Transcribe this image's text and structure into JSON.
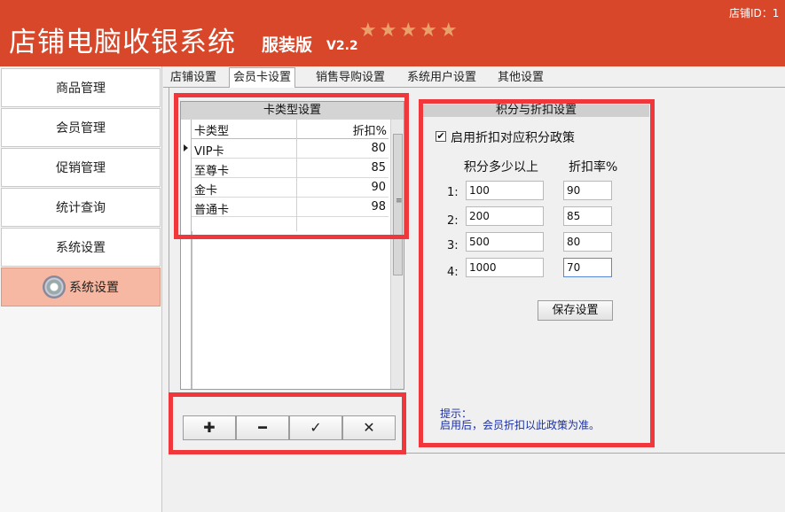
{
  "header": {
    "title": "店铺电脑收银系统",
    "edition": "服装版",
    "version": "V2.2",
    "stars": "★★★★★",
    "shop_id": "店铺ID：1"
  },
  "sidebar": {
    "items": [
      {
        "label": "商品管理"
      },
      {
        "label": "会员管理"
      },
      {
        "label": "促销管理"
      },
      {
        "label": "统计查询"
      },
      {
        "label": "系统设置"
      },
      {
        "label": "系统设置",
        "active": true
      }
    ]
  },
  "tabs": [
    {
      "label": "店铺设置"
    },
    {
      "label": "会员卡设置",
      "active": true
    },
    {
      "label": "销售导购设置"
    },
    {
      "label": "系统用户设置"
    },
    {
      "label": "其他设置"
    }
  ],
  "card_grid": {
    "caption": "卡类型设置",
    "columns": [
      "卡类型",
      "折扣%"
    ],
    "rows": [
      {
        "type": "VIP卡",
        "discount": "80"
      },
      {
        "type": "至尊卡",
        "discount": "85"
      },
      {
        "type": "金卡",
        "discount": "90"
      },
      {
        "type": "普通卡",
        "discount": "98"
      }
    ]
  },
  "grid_buttons": [
    {
      "label": "✚",
      "icon": "plus-icon"
    },
    {
      "label": "━",
      "icon": "minus-icon"
    },
    {
      "label": "✓",
      "icon": "check-icon"
    },
    {
      "label": "✕",
      "icon": "close-icon"
    }
  ],
  "points_panel": {
    "caption": "积分与折扣设置",
    "checkbox_label": "启用折扣对应积分政策",
    "checkbox_checked": true,
    "col_points": "积分多少以上",
    "col_rate": "折扣率%",
    "rows": [
      {
        "num": "1:",
        "points": "100",
        "rate": "90"
      },
      {
        "num": "2:",
        "points": "200",
        "rate": "85"
      },
      {
        "num": "3:",
        "points": "500",
        "rate": "80"
      },
      {
        "num": "4:",
        "points": "1000",
        "rate": "70"
      }
    ],
    "save_label": "保存设置",
    "tip_title": "提示：",
    "tip_text": "启用后，会员折扣以此政策为准。"
  },
  "colors": {
    "header_bg": "#d8472a",
    "active_nav": "#f6b8a2",
    "highlight": "#f0383c",
    "tip_text": "#1a2fa3"
  }
}
